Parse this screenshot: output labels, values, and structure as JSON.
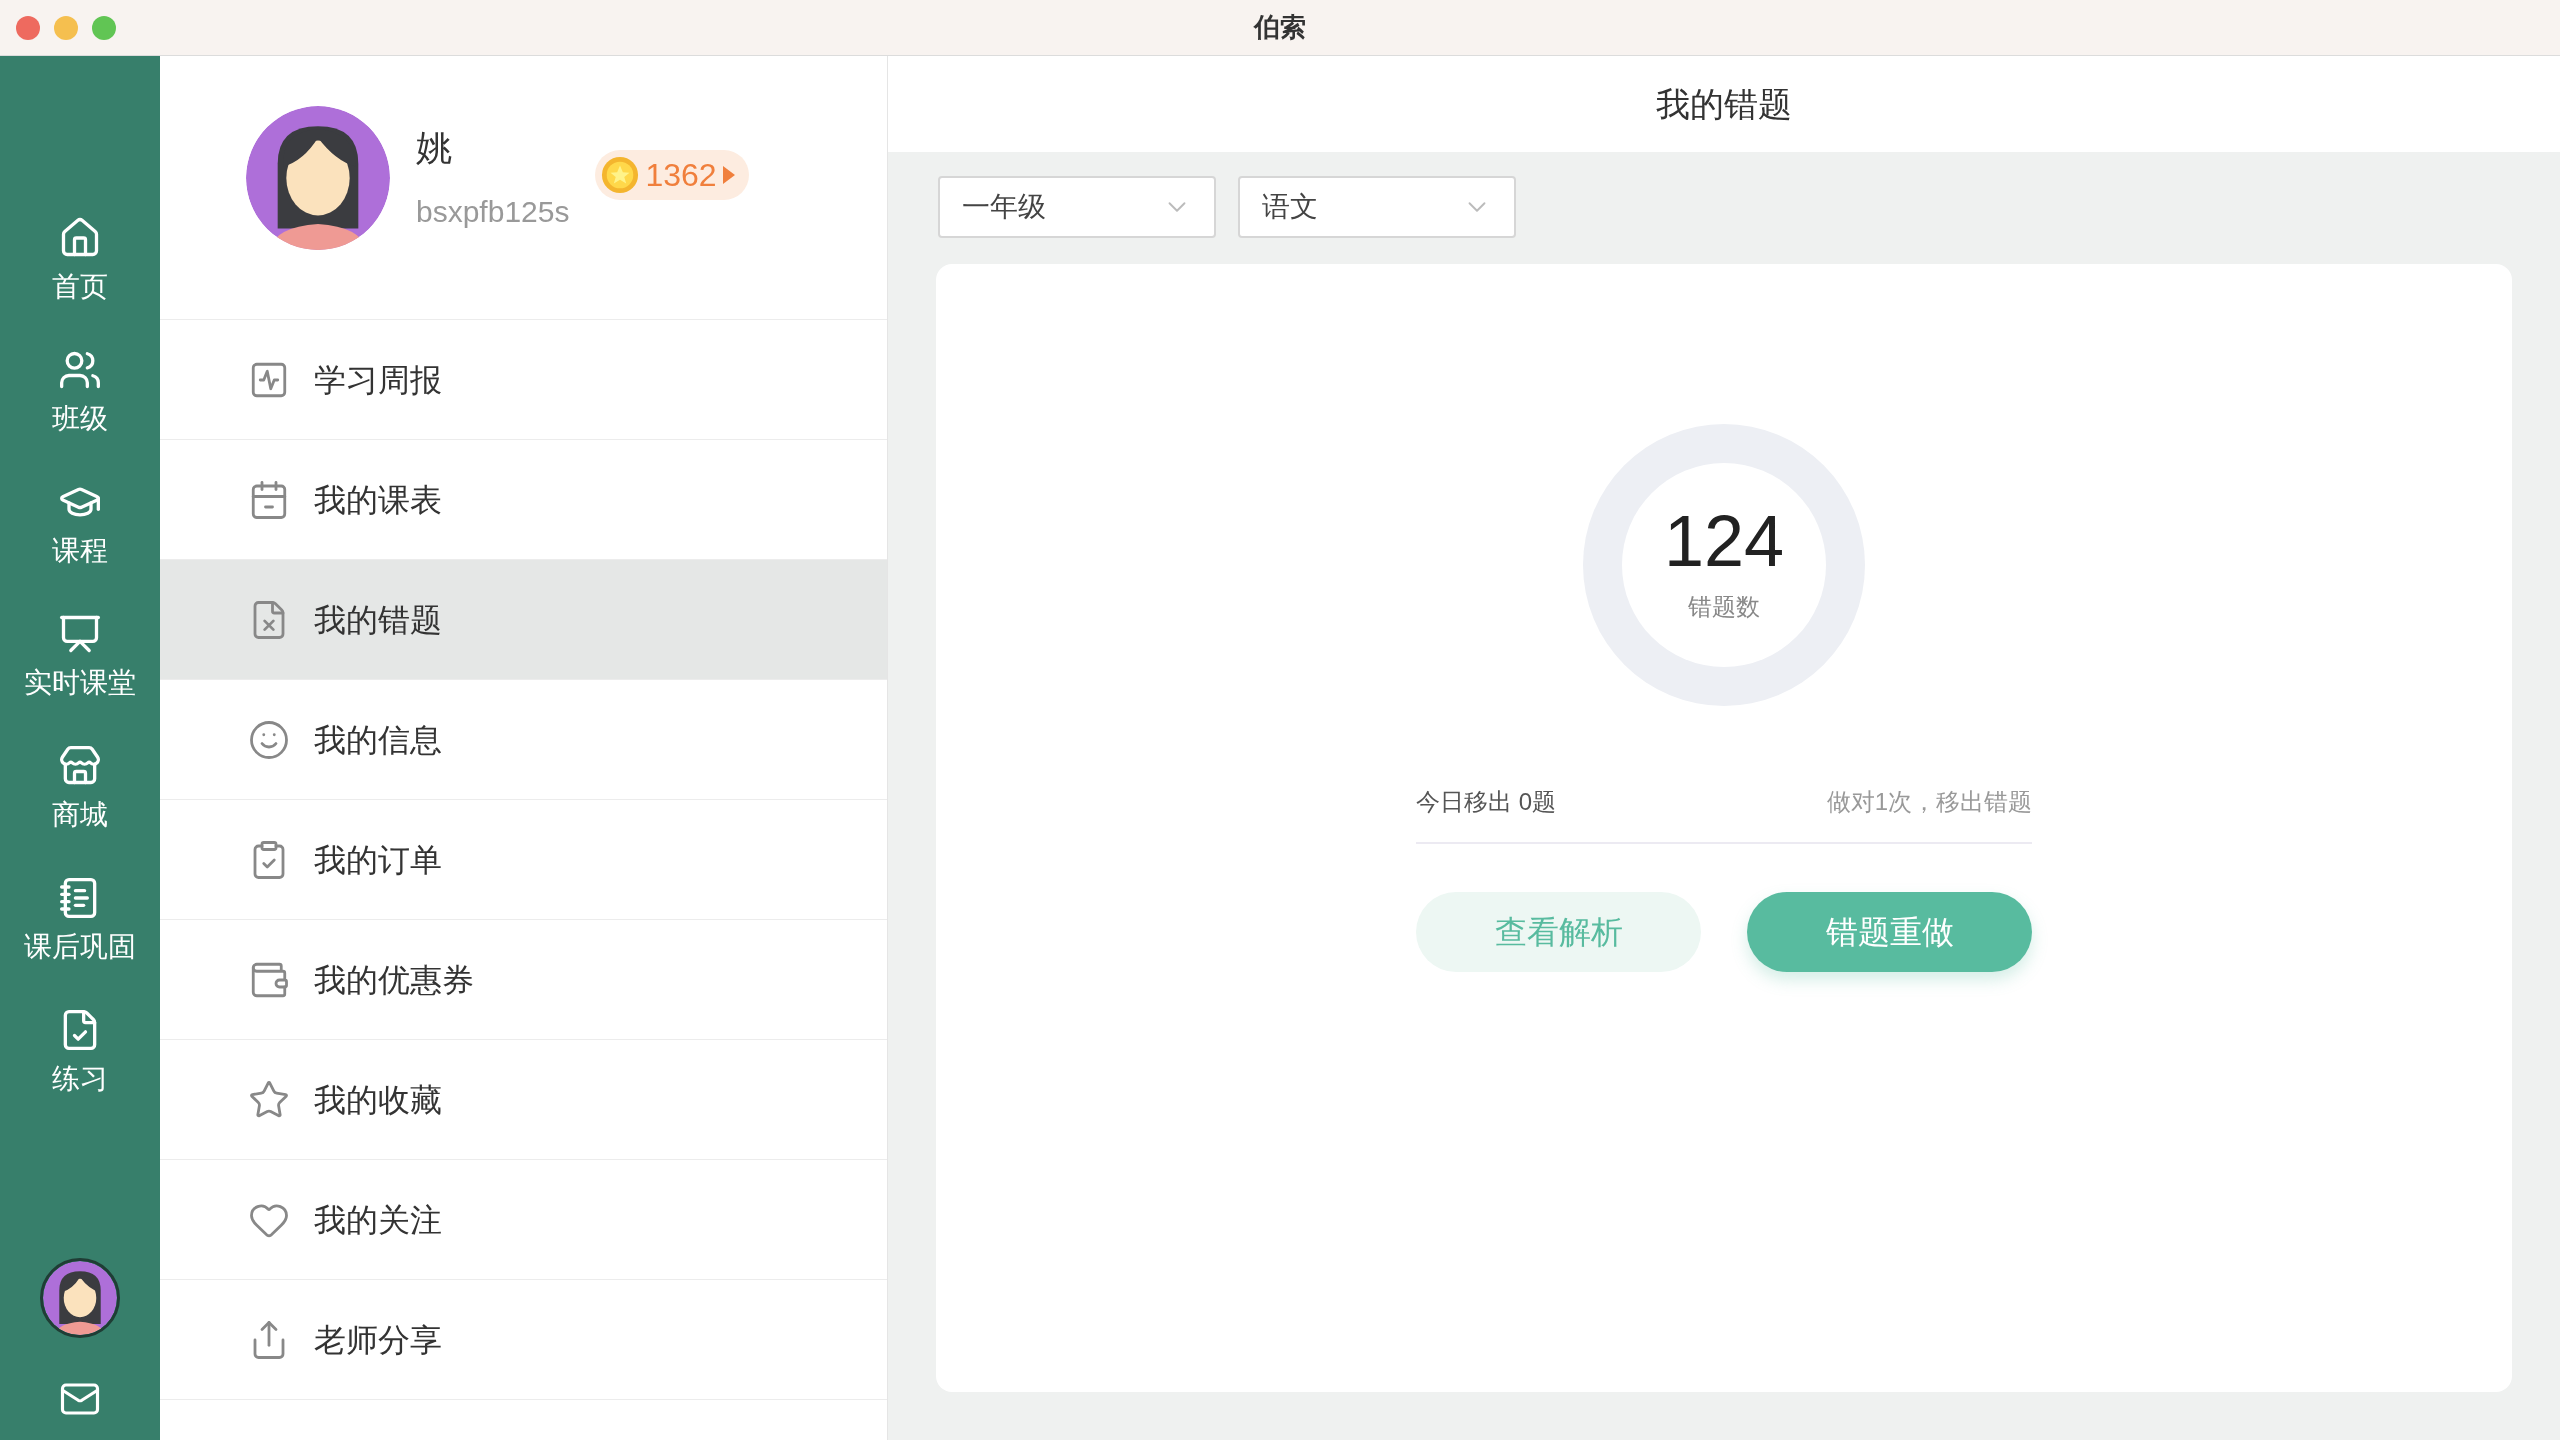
{
  "window": {
    "title": "伯索"
  },
  "nav": [
    {
      "label": "首页"
    },
    {
      "label": "班级"
    },
    {
      "label": "课程"
    },
    {
      "label": "实时课堂"
    },
    {
      "label": "商城"
    },
    {
      "label": "课后巩固"
    },
    {
      "label": "练习"
    }
  ],
  "profile": {
    "name": "姚",
    "username": "bsxpfb125s",
    "coins": "1362"
  },
  "menu": [
    {
      "label": "学习周报",
      "selected": false
    },
    {
      "label": "我的课表",
      "selected": false
    },
    {
      "label": "我的错题",
      "selected": true
    },
    {
      "label": "我的信息",
      "selected": false
    },
    {
      "label": "我的订单",
      "selected": false
    },
    {
      "label": "我的优惠券",
      "selected": false
    },
    {
      "label": "我的收藏",
      "selected": false
    },
    {
      "label": "我的关注",
      "selected": false
    },
    {
      "label": "老师分享",
      "selected": false
    }
  ],
  "page": {
    "title": "我的错题",
    "filters": [
      {
        "value": "一年级"
      },
      {
        "value": "语文"
      }
    ],
    "count": "124",
    "count_label": "错题数",
    "removed_today": "今日移出 0题",
    "rule": "做对1次，移出错题",
    "buttons": [
      {
        "label": "查看解析",
        "kind": "secondary"
      },
      {
        "label": "错题重做",
        "kind": "primary"
      }
    ]
  }
}
